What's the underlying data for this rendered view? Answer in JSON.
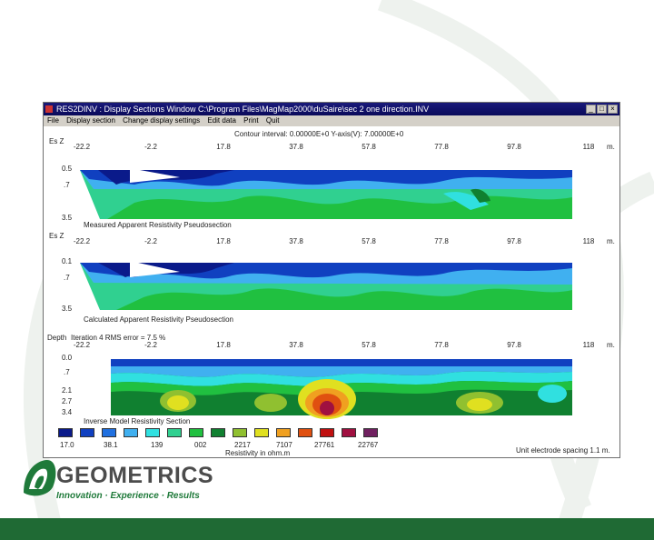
{
  "window": {
    "title": "RES2DINV : Display Sections Window   C:\\Program Files\\MagMap2000\\duSaire\\sec 2 one direction.INV",
    "controls": [
      "_",
      "□",
      "×"
    ]
  },
  "menu": [
    "File",
    "Display section",
    "Change display settings",
    "Edit data",
    "Print",
    "Quit"
  ],
  "header_coords": "Contour interval: 0.00000E+0  Y-axis(V): 7.00000E+0",
  "sections": [
    {
      "depth_axis_label": "Es Z",
      "x_ticks": [
        "-22.2",
        "-2.2",
        "17.8",
        "37.8",
        "57.8",
        "77.8",
        "97.8",
        "118"
      ],
      "y_ticks": [
        "0.5",
        ".7",
        "3.5"
      ],
      "caption": "Measured Apparent Resistivity Pseudosection"
    },
    {
      "depth_axis_label": "Es Z",
      "x_ticks": [
        "-22.2",
        "-2.2",
        "17.8",
        "37.8",
        "57.8",
        "77.8",
        "97.8",
        "118"
      ],
      "y_ticks": [
        "0.1",
        ".7",
        "3.5"
      ],
      "caption": "Calculated Apparent Resistivity Pseudosection"
    },
    {
      "depth_axis_label": "Depth",
      "header": "Iteration 4 RMS error = 7.5 %",
      "x_ticks": [
        "-22.2",
        "-2.2",
        "17.8",
        "37.8",
        "57.8",
        "77.8",
        "97.8",
        "118"
      ],
      "y_ticks": [
        "0.0",
        ".7",
        "2.1",
        "2.7",
        "3.4"
      ],
      "caption": "Inverse Model Resistivity Section"
    }
  ],
  "x_unit": "m.",
  "legend": {
    "colors": [
      "#0a1a8a",
      "#1040c0",
      "#2070e0",
      "#40b0f0",
      "#30e0e0",
      "#30d090",
      "#20c040",
      "#108030",
      "#90c030",
      "#e0e020",
      "#f0a020",
      "#e05010",
      "#c01010",
      "#a01040",
      "#702060"
    ],
    "labels": [
      "17.0",
      "38.1",
      "139",
      "002",
      "2217",
      "7107",
      "27761",
      "22767"
    ],
    "title": "Resistivity in ohm.m",
    "spacing_note": "Unit electrode spacing 1.1 m."
  },
  "brand": {
    "name": "GEOMETRICS",
    "tagline": "Innovation · Experience · Results",
    "primary_color": "#1f6a34"
  }
}
